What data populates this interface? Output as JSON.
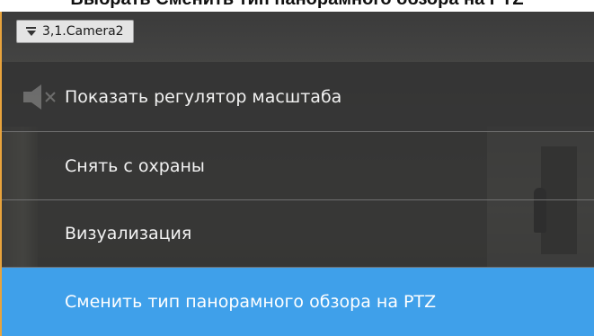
{
  "document": {
    "heading": "Выбрать Сменить тип панорамного обзора на PTZ"
  },
  "camera": {
    "title": "3,1.Camera2",
    "frame_color": "#e8a33c"
  },
  "menu": {
    "items": [
      {
        "label": "Показать регулятор масштаба"
      },
      {
        "label": "Снять с охраны"
      },
      {
        "label": "Визуализация"
      },
      {
        "label": "Сменить тип панорамного обзора на PTZ",
        "highlighted": true
      }
    ],
    "highlight_color": "#3fa0ea"
  },
  "icons": {
    "title_caret": "dropdown-caret-icon",
    "speaker": "speaker-muted-icon"
  }
}
